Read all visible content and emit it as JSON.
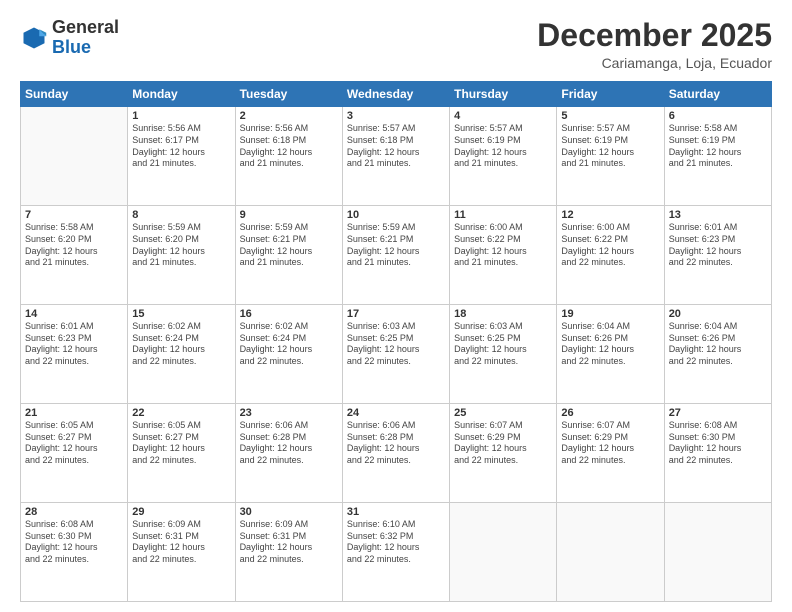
{
  "header": {
    "logo_general": "General",
    "logo_blue": "Blue",
    "month_title": "December 2025",
    "location": "Cariamanga, Loja, Ecuador"
  },
  "days_of_week": [
    "Sunday",
    "Monday",
    "Tuesday",
    "Wednesday",
    "Thursday",
    "Friday",
    "Saturday"
  ],
  "weeks": [
    [
      {
        "day": "",
        "info": ""
      },
      {
        "day": "1",
        "info": "Sunrise: 5:56 AM\nSunset: 6:17 PM\nDaylight: 12 hours\nand 21 minutes."
      },
      {
        "day": "2",
        "info": "Sunrise: 5:56 AM\nSunset: 6:18 PM\nDaylight: 12 hours\nand 21 minutes."
      },
      {
        "day": "3",
        "info": "Sunrise: 5:57 AM\nSunset: 6:18 PM\nDaylight: 12 hours\nand 21 minutes."
      },
      {
        "day": "4",
        "info": "Sunrise: 5:57 AM\nSunset: 6:19 PM\nDaylight: 12 hours\nand 21 minutes."
      },
      {
        "day": "5",
        "info": "Sunrise: 5:57 AM\nSunset: 6:19 PM\nDaylight: 12 hours\nand 21 minutes."
      },
      {
        "day": "6",
        "info": "Sunrise: 5:58 AM\nSunset: 6:19 PM\nDaylight: 12 hours\nand 21 minutes."
      }
    ],
    [
      {
        "day": "7",
        "info": "Sunrise: 5:58 AM\nSunset: 6:20 PM\nDaylight: 12 hours\nand 21 minutes."
      },
      {
        "day": "8",
        "info": "Sunrise: 5:59 AM\nSunset: 6:20 PM\nDaylight: 12 hours\nand 21 minutes."
      },
      {
        "day": "9",
        "info": "Sunrise: 5:59 AM\nSunset: 6:21 PM\nDaylight: 12 hours\nand 21 minutes."
      },
      {
        "day": "10",
        "info": "Sunrise: 5:59 AM\nSunset: 6:21 PM\nDaylight: 12 hours\nand 21 minutes."
      },
      {
        "day": "11",
        "info": "Sunrise: 6:00 AM\nSunset: 6:22 PM\nDaylight: 12 hours\nand 21 minutes."
      },
      {
        "day": "12",
        "info": "Sunrise: 6:00 AM\nSunset: 6:22 PM\nDaylight: 12 hours\nand 22 minutes."
      },
      {
        "day": "13",
        "info": "Sunrise: 6:01 AM\nSunset: 6:23 PM\nDaylight: 12 hours\nand 22 minutes."
      }
    ],
    [
      {
        "day": "14",
        "info": "Sunrise: 6:01 AM\nSunset: 6:23 PM\nDaylight: 12 hours\nand 22 minutes."
      },
      {
        "day": "15",
        "info": "Sunrise: 6:02 AM\nSunset: 6:24 PM\nDaylight: 12 hours\nand 22 minutes."
      },
      {
        "day": "16",
        "info": "Sunrise: 6:02 AM\nSunset: 6:24 PM\nDaylight: 12 hours\nand 22 minutes."
      },
      {
        "day": "17",
        "info": "Sunrise: 6:03 AM\nSunset: 6:25 PM\nDaylight: 12 hours\nand 22 minutes."
      },
      {
        "day": "18",
        "info": "Sunrise: 6:03 AM\nSunset: 6:25 PM\nDaylight: 12 hours\nand 22 minutes."
      },
      {
        "day": "19",
        "info": "Sunrise: 6:04 AM\nSunset: 6:26 PM\nDaylight: 12 hours\nand 22 minutes."
      },
      {
        "day": "20",
        "info": "Sunrise: 6:04 AM\nSunset: 6:26 PM\nDaylight: 12 hours\nand 22 minutes."
      }
    ],
    [
      {
        "day": "21",
        "info": "Sunrise: 6:05 AM\nSunset: 6:27 PM\nDaylight: 12 hours\nand 22 minutes."
      },
      {
        "day": "22",
        "info": "Sunrise: 6:05 AM\nSunset: 6:27 PM\nDaylight: 12 hours\nand 22 minutes."
      },
      {
        "day": "23",
        "info": "Sunrise: 6:06 AM\nSunset: 6:28 PM\nDaylight: 12 hours\nand 22 minutes."
      },
      {
        "day": "24",
        "info": "Sunrise: 6:06 AM\nSunset: 6:28 PM\nDaylight: 12 hours\nand 22 minutes."
      },
      {
        "day": "25",
        "info": "Sunrise: 6:07 AM\nSunset: 6:29 PM\nDaylight: 12 hours\nand 22 minutes."
      },
      {
        "day": "26",
        "info": "Sunrise: 6:07 AM\nSunset: 6:29 PM\nDaylight: 12 hours\nand 22 minutes."
      },
      {
        "day": "27",
        "info": "Sunrise: 6:08 AM\nSunset: 6:30 PM\nDaylight: 12 hours\nand 22 minutes."
      }
    ],
    [
      {
        "day": "28",
        "info": "Sunrise: 6:08 AM\nSunset: 6:30 PM\nDaylight: 12 hours\nand 22 minutes."
      },
      {
        "day": "29",
        "info": "Sunrise: 6:09 AM\nSunset: 6:31 PM\nDaylight: 12 hours\nand 22 minutes."
      },
      {
        "day": "30",
        "info": "Sunrise: 6:09 AM\nSunset: 6:31 PM\nDaylight: 12 hours\nand 22 minutes."
      },
      {
        "day": "31",
        "info": "Sunrise: 6:10 AM\nSunset: 6:32 PM\nDaylight: 12 hours\nand 22 minutes."
      },
      {
        "day": "",
        "info": ""
      },
      {
        "day": "",
        "info": ""
      },
      {
        "day": "",
        "info": ""
      }
    ]
  ]
}
